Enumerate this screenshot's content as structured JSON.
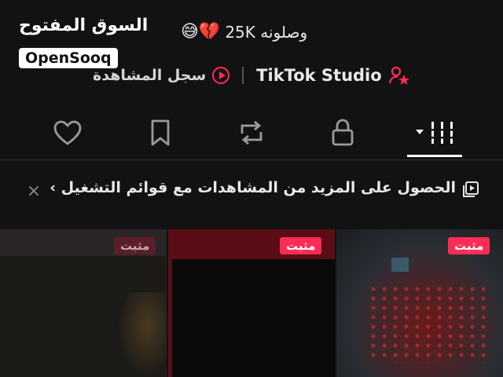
{
  "watermark": {
    "arabic": "السوق المفتوح",
    "latin": "OpenSooq"
  },
  "profile": {
    "followers_text": "وصلونه 25K",
    "emojis": "😅💔",
    "history_label": "سجل المشاهدة",
    "studio_label": "TikTok Studio"
  },
  "tabs": [
    {
      "name": "videos",
      "icon": "grid-icon",
      "selected": true
    },
    {
      "name": "private",
      "icon": "lock-icon"
    },
    {
      "name": "reposts",
      "icon": "repost-icon"
    },
    {
      "name": "favorites",
      "icon": "bookmark-icon"
    },
    {
      "name": "liked",
      "icon": "heart-icon"
    }
  ],
  "banner": {
    "text": "الحصول على المزيد من المشاهدات مع قوائم التشغيل ›",
    "close": "×"
  },
  "grid": {
    "items": [
      {
        "pin_label": "مثبت",
        "overlay_text": ""
      },
      {
        "pin_label": "مثبت",
        "overlay_text": ""
      },
      {
        "pin_label": "مثبت",
        "overlay_text": ""
      }
    ]
  },
  "colors": {
    "accent": "#fe2c55",
    "background": "#121212",
    "text": "#e8e8e8"
  }
}
